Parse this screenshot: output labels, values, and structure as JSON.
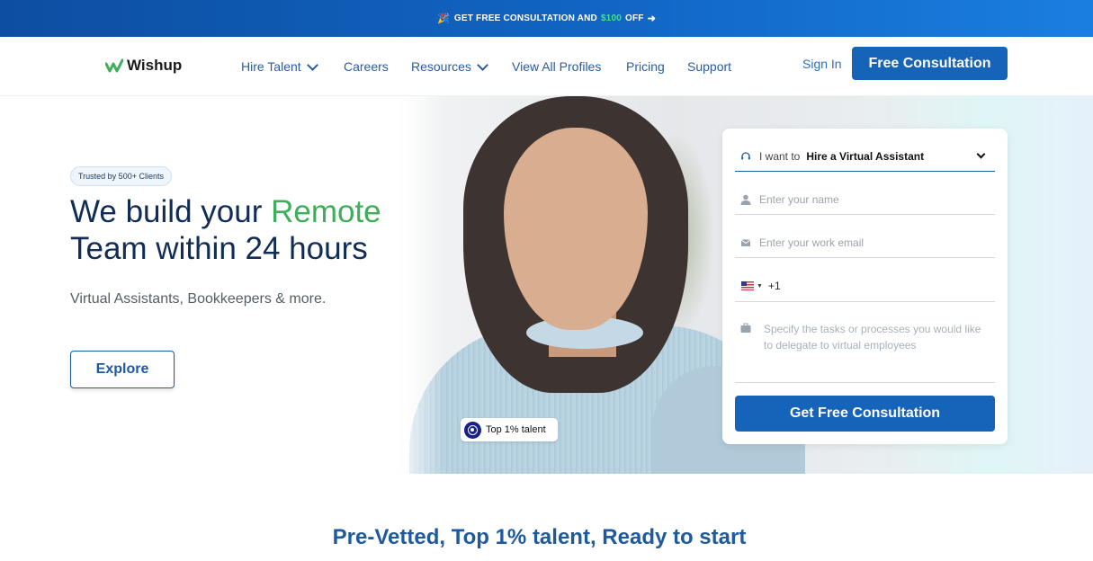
{
  "promo": {
    "emoji": "🎉",
    "text_before": "GET FREE CONSULTATION AND",
    "highlight": "$100",
    "text_after": "OFF",
    "arrow": "➜"
  },
  "nav": {
    "logo": "Wishup",
    "items": [
      {
        "label": "Hire Talent",
        "dropdown": true
      },
      {
        "label": "Careers",
        "dropdown": false
      },
      {
        "label": "Resources",
        "dropdown": true
      },
      {
        "label": "View All Profiles",
        "dropdown": false
      },
      {
        "label": "Pricing",
        "dropdown": false
      },
      {
        "label": "Support",
        "dropdown": false
      }
    ],
    "sign_in": "Sign In",
    "cta": "Free Consultation"
  },
  "hero": {
    "trusted_badge": "Trusted by 500+ Clients",
    "headline_part1": "We build your",
    "headline_accent": "Remote",
    "headline_part2": "Team within 24 hours",
    "subtitle": "Virtual Assistants, Bookkeepers & more.",
    "explore_label": "Explore",
    "talent_badge": "Top 1% talent"
  },
  "form": {
    "want_label": "I want to",
    "want_value": "Hire a Virtual Assistant",
    "name_placeholder": "Enter your name",
    "email_placeholder": "Enter your work email",
    "phone_code": "+1",
    "tasks_placeholder": "Specify the tasks or processes you would like to delegate to virtual employees",
    "submit_label": "Get Free Consultation"
  },
  "section": {
    "title": "Pre-Vetted, Top 1% talent, Ready to start"
  },
  "colors": {
    "primary": "#1663ba",
    "accent_green": "#3fae5a",
    "heading": "#112d55",
    "promo_green": "#4be08a"
  }
}
